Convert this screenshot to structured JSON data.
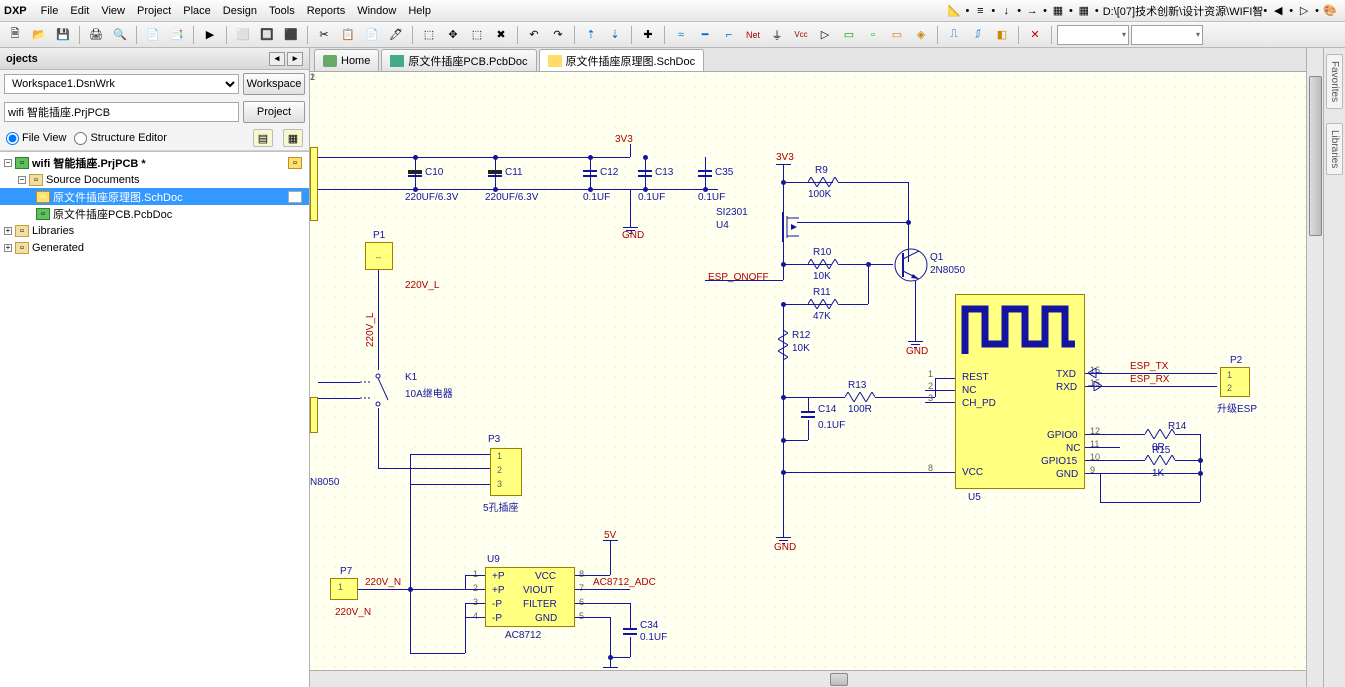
{
  "menu": {
    "app": "DXP",
    "items": [
      "File",
      "Edit",
      "View",
      "Project",
      "Place",
      "Design",
      "Tools",
      "Reports",
      "Window",
      "Help"
    ],
    "path": "D:\\[07]技术创新\\设计资源\\WIFI智"
  },
  "panel": {
    "title": "ojects",
    "workspace": "Workspace1.DsnWrk",
    "ws_btn": "Workspace",
    "project": "wifi 智能插座.PrjPCB",
    "proj_btn": "Project",
    "radio1": "File View",
    "radio2": "Structure Editor",
    "tree": {
      "root": "wifi 智能插座.PrjPCB *",
      "src": "Source Documents",
      "sch": "原文件插座原理图.SchDoc",
      "pcb": "原文件插座PCB.PcbDoc",
      "libs": "Libraries",
      "gen": "Generated"
    }
  },
  "tabs": {
    "home": "Home",
    "pcb": "原文件插座PCB.PcbDoc",
    "sch": "原文件插座原理图.SchDoc"
  },
  "rtabs": [
    "Favorites",
    "Libraries"
  ],
  "sch": {
    "nets": {
      "v33": "3V3",
      "gnd": "GND",
      "v5": "5V",
      "esp_onoff": "ESP_ONOFF",
      "esp_tx": "ESP_TX",
      "esp_rx": "ESP_RX",
      "l220": "220V_L",
      "n220": "220V_N",
      "ac_adc": "AC8712_ADC"
    },
    "parts": {
      "c10": {
        "ref": "C10",
        "val": "220UF/6.3V"
      },
      "c11": {
        "ref": "C11",
        "val": "220UF/6.3V"
      },
      "c12": {
        "ref": "C12",
        "val": "0.1UF"
      },
      "c13": {
        "ref": "C13",
        "val": "0.1UF"
      },
      "c35": {
        "ref": "C35",
        "val": "0.1UF"
      },
      "c14": {
        "ref": "C14",
        "val": "0.1UF"
      },
      "c34": {
        "ref": "C34",
        "val": "0.1UF"
      },
      "r9": {
        "ref": "R9",
        "val": "100K"
      },
      "r10": {
        "ref": "R10",
        "val": "10K"
      },
      "r11": {
        "ref": "R11",
        "val": "47K"
      },
      "r12": {
        "ref": "R12",
        "val": "10K"
      },
      "r13": {
        "ref": "R13",
        "val": "100R"
      },
      "r14": {
        "ref": "R14",
        "val": "0R"
      },
      "r15": {
        "ref": "R15",
        "val": "1K"
      },
      "q1": {
        "ref": "Q1",
        "val": "2N8050"
      },
      "u4": {
        "ref": "SI2301",
        "val": "U4"
      },
      "u5": "U5",
      "u9": {
        "ref": "U9",
        "val": "AC8712"
      },
      "k1": {
        "ref": "K1",
        "val": "10A继电器"
      },
      "p1": "P1",
      "p2": {
        "ref": "P2",
        "val": "升级ESP"
      },
      "p3": {
        "ref": "P3",
        "val": "5孔插座"
      },
      "p7": "P7",
      "n8050": "N8050"
    },
    "u5_pins": {
      "rest": "REST",
      "nc": "NC",
      "chpd": "CH_PD",
      "vcc": "VCC",
      "txd": "TXD",
      "rxd": "RXD",
      "gpio0": "GPIO0",
      "nc2": "NC",
      "gpio15": "GPIO15",
      "gnd": "GND"
    },
    "u9_pins": {
      "p1": "+P",
      "p2": "+P",
      "p3": "-P",
      "p4": "-P",
      "vcc": "VCC",
      "viout": "VIOUT",
      "filter": "FILTER",
      "gnd": "GND"
    },
    "pins": {
      "n1": "1",
      "n2": "2",
      "n3": "3",
      "n4": "4",
      "n5": "5",
      "n6": "6",
      "n7": "7",
      "n8": "8",
      "n9": "9",
      "n10": "10",
      "n11": "11",
      "n12": "12",
      "n15": "15",
      "n16": "16"
    }
  }
}
